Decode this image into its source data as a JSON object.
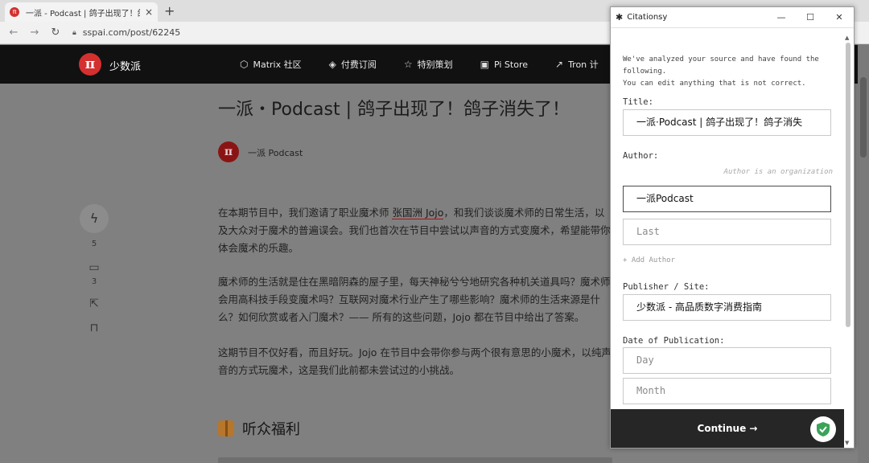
{
  "browser": {
    "tab_title": "一派 - Podcast | 鸽子出现了！鸽",
    "tab_close": "×",
    "new_tab": "+",
    "url": "sspai.com/post/62245"
  },
  "site": {
    "logo": "π",
    "brand": "少数派",
    "nav": [
      {
        "label": "Matrix 社区",
        "icon": "cube-icon"
      },
      {
        "label": "付费订阅",
        "icon": "subscription-icon"
      },
      {
        "label": "特别策划",
        "icon": "star-icon"
      },
      {
        "label": "Pi Store",
        "icon": "store-icon"
      },
      {
        "label": "Tron 计",
        "icon": "tron-icon"
      }
    ]
  },
  "article": {
    "title": "一派・Podcast | 鸽子出现了！鸽子消失了！",
    "author_avatar": "π",
    "author": "一派 Podcast",
    "charge_count": "5",
    "comment_count": "3",
    "p1_a": "在本期节目中，我们邀请了职业魔术师 ",
    "p1_link": "张国洲 Jojo",
    "p1_b": "，和我们谈谈魔术师的日常生活，以及大众对于魔术的普遍误会。我们也首次在节目中尝试以声音的方式变魔术，希望能带你体会魔术的乐趣。",
    "p2": "魔术师的生活就是住在黑暗阴森的屋子里，每天神秘兮兮地研究各种机关道具吗？魔术师会用高科技手段变魔术吗？互联网对魔术行业产生了哪些影响？魔术师的生活来源是什么？如何欣赏或者入门魔术？—— 所有的这些问题，Jojo 都在节目中给出了答案。",
    "p3": "这期节目不仅好看，而且好玩。Jojo 在节目中会带你参与两个很有意思的小魔术，以纯声音的方式玩魔术，这是我们此前都未尝试过的小挑战。",
    "section_heading": "听众福利"
  },
  "popup": {
    "app_name": "Citationsy",
    "intro": "We've analyzed your source and have found the following.\nYou can edit anything that is not correct.",
    "title_label": "Title:",
    "title_value": "一派·Podcast | 鸽子出现了！鸽子消失",
    "author_label": "Author:",
    "author_org_note": "Author is an organization",
    "author_first": "一派Podcast",
    "author_last_placeholder": "Last",
    "add_author": "+ Add Author",
    "publisher_label": "Publisher / Site:",
    "publisher_value": "少数派 - 高品质数字消费指南",
    "date_label": "Date of Publication:",
    "day_placeholder": "Day",
    "month_placeholder": "Month",
    "continue_label": "Continue →",
    "colors": {
      "continue_bg": "#262626",
      "shield_green": "#3aa35a"
    }
  }
}
